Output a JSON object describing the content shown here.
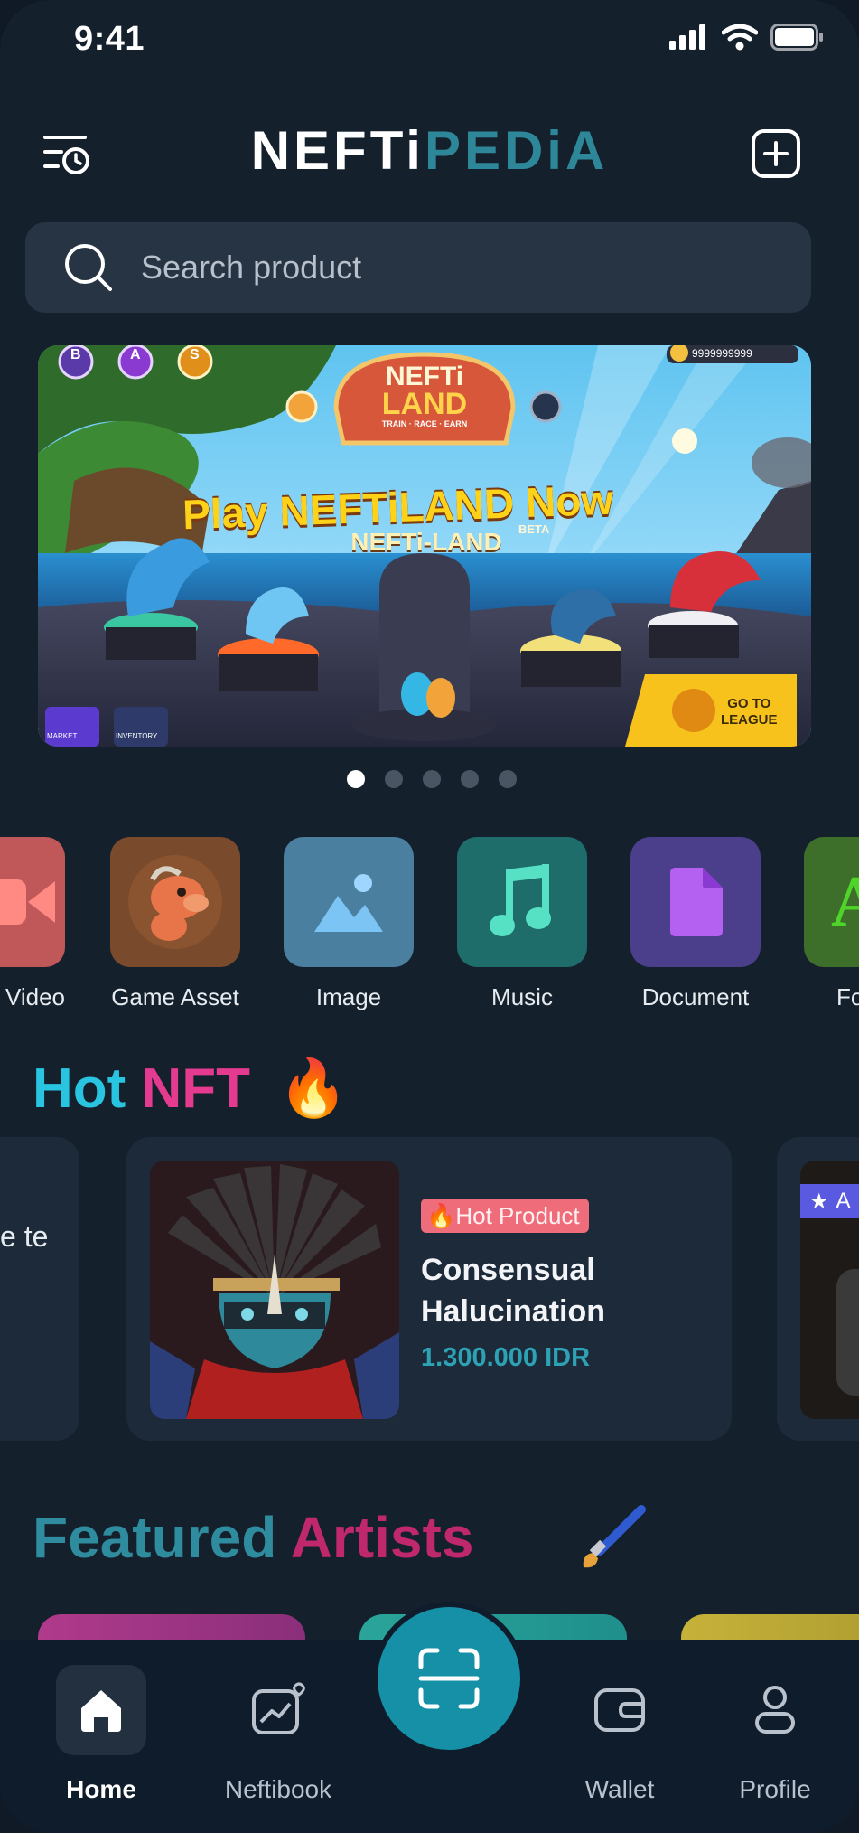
{
  "status_bar": {
    "time": "9:41"
  },
  "header": {
    "logo_part1": "NEFTi",
    "logo_part2": "PEDiA",
    "history_icon": "history-menu-icon",
    "add_icon": "plus-square-icon"
  },
  "search": {
    "placeholder": "Search product"
  },
  "banner": {
    "headline": "Play NEFTiLAND Now",
    "beta": "BETA",
    "subtitle": "NEFTi-LAND",
    "logo_line1": "NEFTi",
    "logo_line2": "LAND",
    "logo_tagline": "TRAIN · RACE · EARN",
    "coins": "9999999999",
    "cta_line1": "GO TO",
    "cta_line2": "LEAGUE",
    "rank_badges": [
      "B",
      "A",
      "S"
    ],
    "market": "MARKET",
    "inventory": "INVENTORY",
    "slides_total": 5,
    "active_slide": 1
  },
  "categories": [
    {
      "label": "Video",
      "icon": "video-icon",
      "color": "#c0585a"
    },
    {
      "label": "Game Asset",
      "icon": "dragon-avatar",
      "color": "#7a4a2c"
    },
    {
      "label": "Image",
      "icon": "image-icon",
      "color": "#4a7f9f"
    },
    {
      "label": "Music",
      "icon": "music-icon",
      "color": "#1e6d6a"
    },
    {
      "label": "Document",
      "icon": "document-icon",
      "color": "#4b3f8c"
    },
    {
      "label": "Font",
      "icon": "font-icon",
      "color": "#3d6e2a"
    }
  ],
  "hot_nft": {
    "title_part1": "Hot",
    "title_part2": "NFT",
    "title_emoji": "🔥",
    "left_card_text": "e te",
    "main_card": {
      "badge": "🔥Hot Product",
      "name": "Consensual Halucination",
      "price": "1.300.000 IDR"
    },
    "right_card_badge": "A"
  },
  "featured": {
    "title_part1": "Featured",
    "title_part2": "Artists",
    "emoji": "🖌️"
  },
  "bottom_nav": {
    "home": "Home",
    "neftibook": "Neftibook",
    "scan_icon": "scan-icon",
    "wallet": "Wallet",
    "profile": "Profile",
    "active": "home"
  }
}
